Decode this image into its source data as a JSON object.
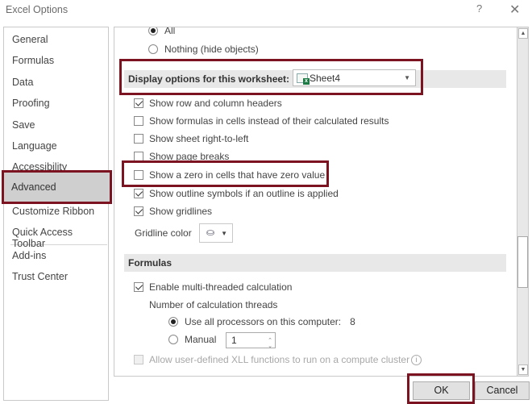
{
  "window": {
    "title": "Excel Options",
    "help": "?",
    "close": "✕"
  },
  "sidebar": {
    "items": [
      {
        "label": "General"
      },
      {
        "label": "Formulas"
      },
      {
        "label": "Data"
      },
      {
        "label": "Proofing"
      },
      {
        "label": "Save"
      },
      {
        "label": "Language"
      },
      {
        "label": "Accessibility"
      },
      {
        "label": "Advanced",
        "selected": true
      },
      {
        "label": "Customize Ribbon"
      },
      {
        "label": "Quick Access Toolbar"
      },
      {
        "label": "Add-ins"
      },
      {
        "label": "Trust Center"
      }
    ]
  },
  "objects": {
    "all_label": "All",
    "nothing_label": "Nothing (hide objects)"
  },
  "worksheet_section": {
    "title": "Display options for this worksheet:",
    "sheet_value": "Sheet4",
    "options": [
      {
        "label": "Show row and column headers",
        "checked": true
      },
      {
        "label": "Show formulas in cells instead of their calculated results",
        "checked": false
      },
      {
        "label": "Show sheet right-to-left",
        "checked": false
      },
      {
        "label": "Show page breaks",
        "checked": false
      },
      {
        "label": "Show a zero in cells that have zero value",
        "checked": false
      },
      {
        "label": "Show outline symbols if an outline is applied",
        "checked": true
      },
      {
        "label": "Show gridlines",
        "checked": true
      }
    ],
    "gridline_color_label": "Gridline color"
  },
  "formulas_section": {
    "title": "Formulas",
    "multithread_label": "Enable multi-threaded calculation",
    "threads_label": "Number of calculation threads",
    "all_processors_label": "Use all processors on this computer:",
    "processor_count": "8",
    "manual_label": "Manual",
    "manual_value": "1",
    "xll_label": "Allow user-defined XLL functions to run on a compute cluster"
  },
  "buttons": {
    "ok": "OK",
    "cancel": "Cancel"
  },
  "colors": {
    "highlight": "#7b1420",
    "selected_nav": "#cfcfcf",
    "section_bg": "#e8e8e8"
  }
}
